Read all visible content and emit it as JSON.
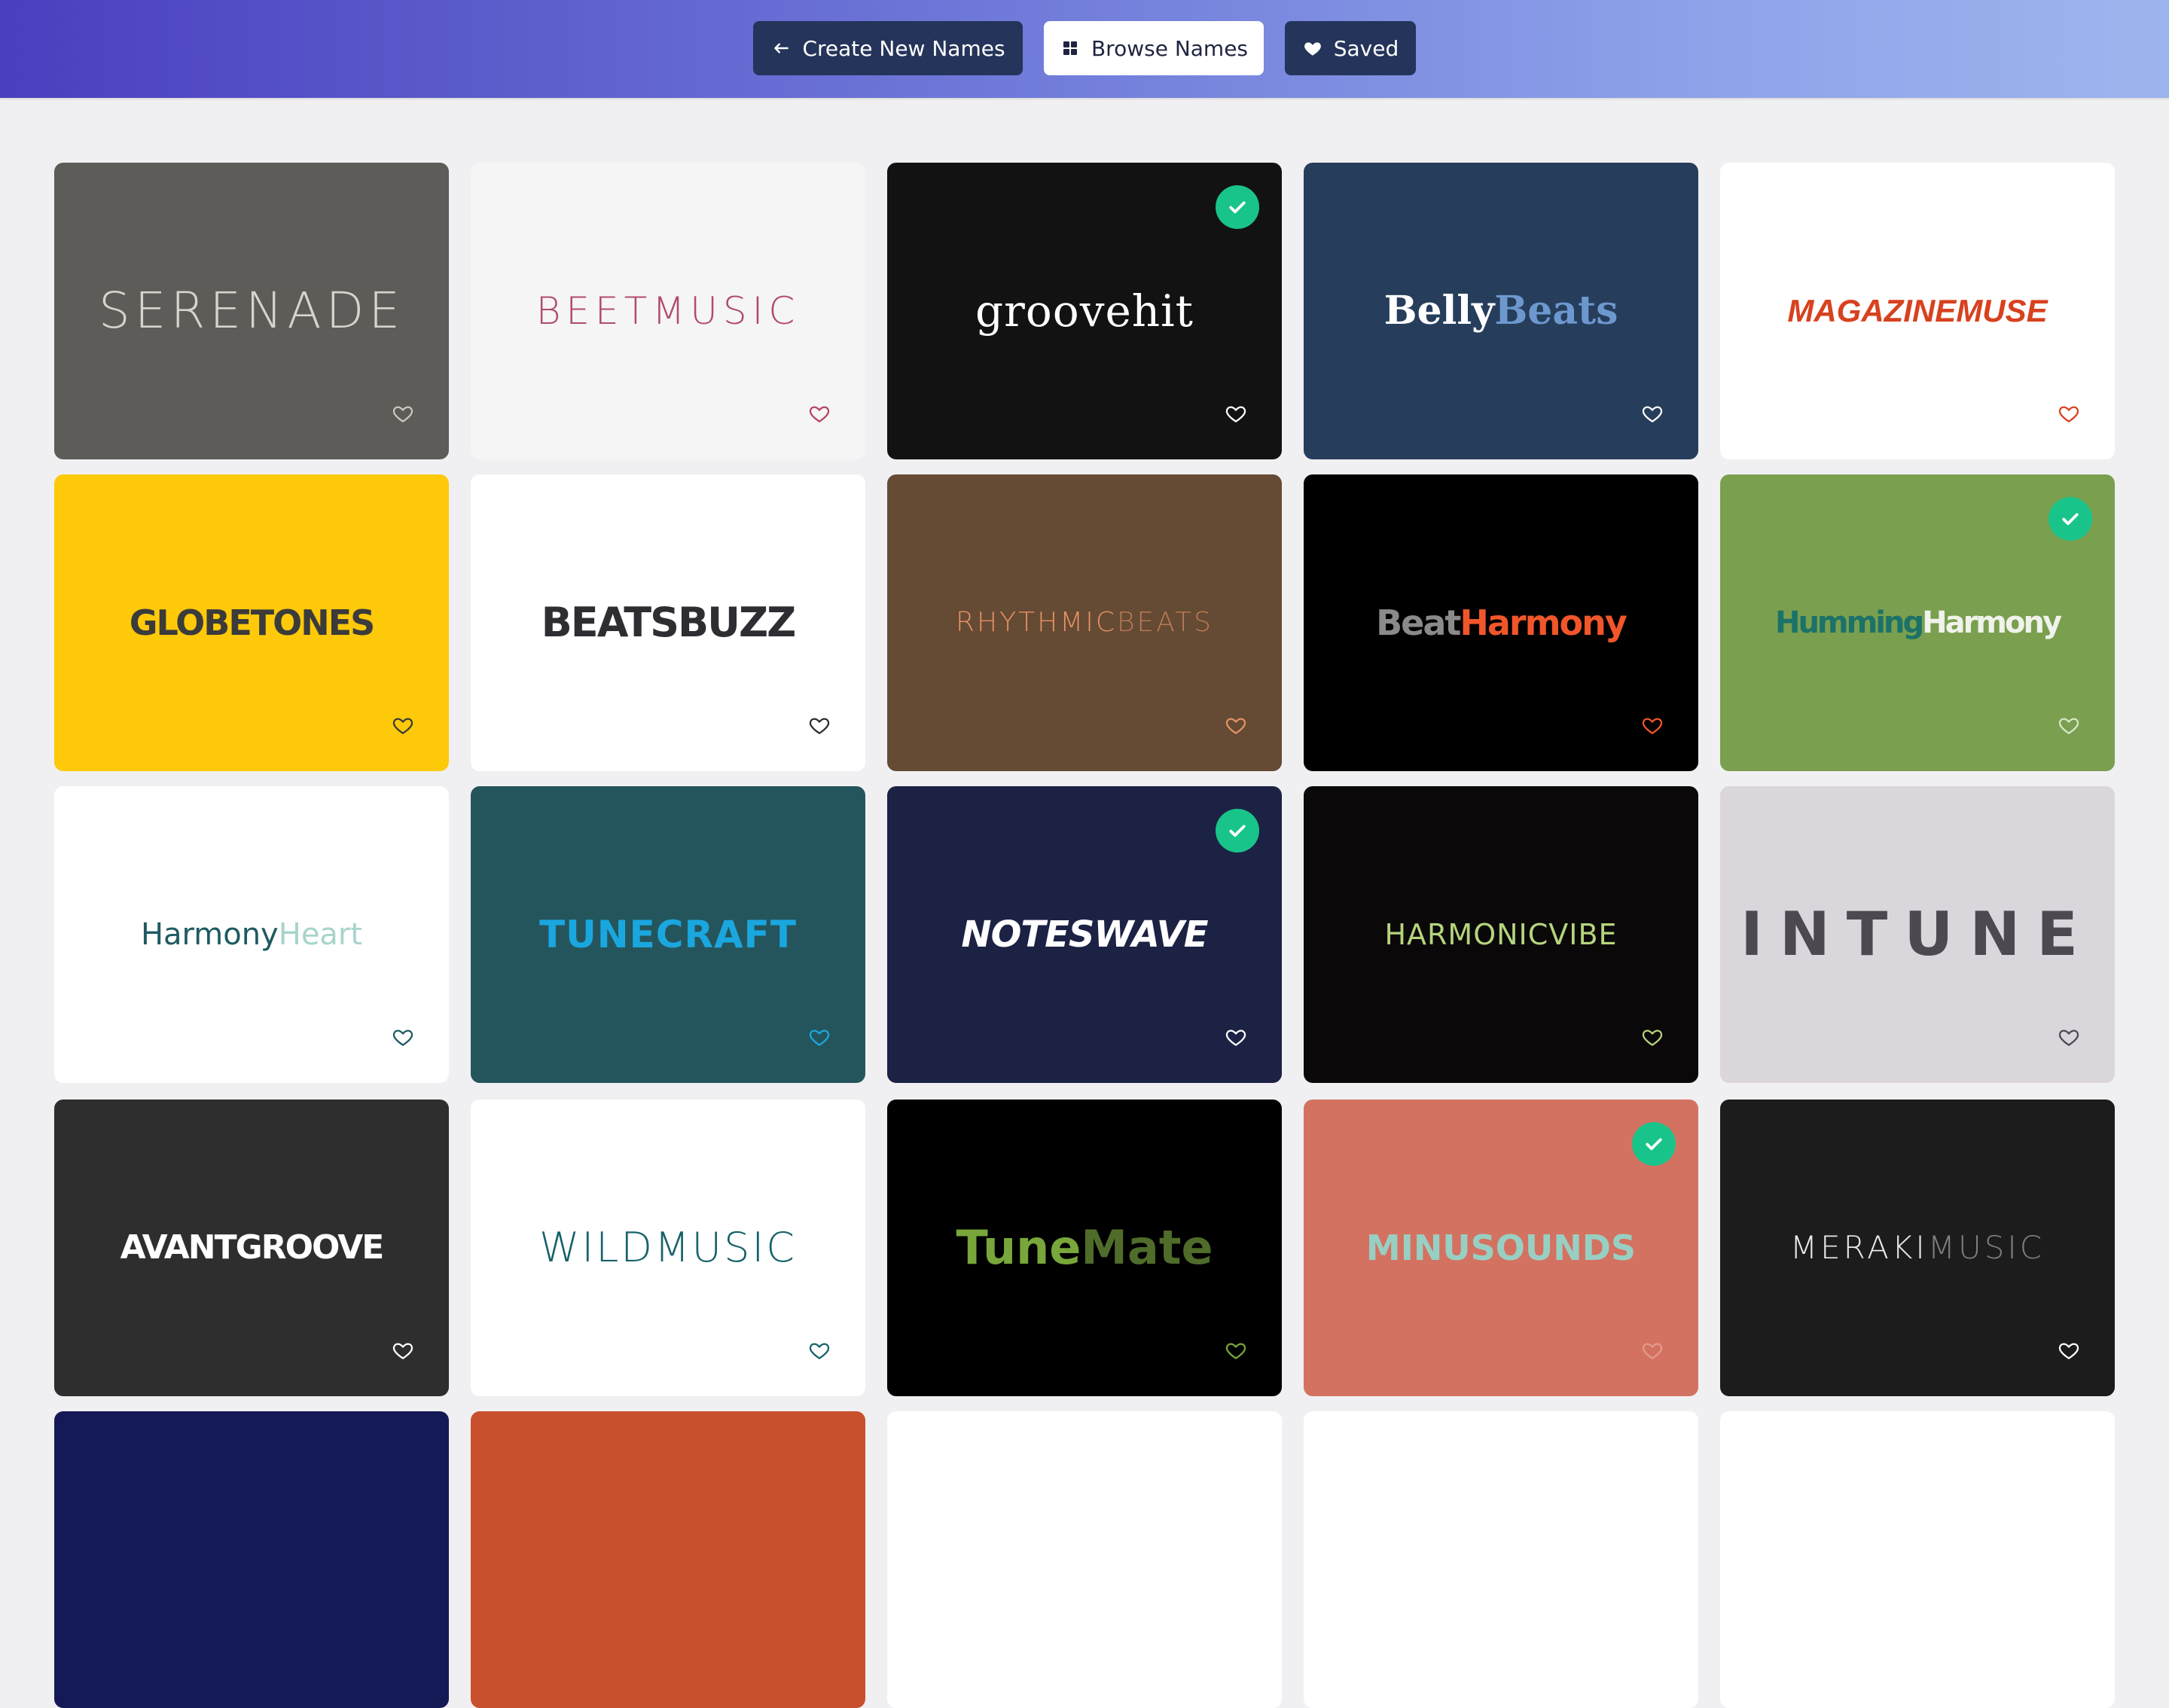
{
  "nav": {
    "create_label": "Create New Names",
    "create_icon": "arrow-left-icon",
    "browse_label": "Browse Names",
    "browse_icon": "grid-icon",
    "saved_label": "Saved",
    "saved_icon": "heart-filled-icon"
  },
  "colors": {
    "nav_dark": "#25345a",
    "check_green": "#19c48a"
  },
  "cards": [
    {
      "name": "SERENADE",
      "bg": "#5d5c58",
      "parts": [
        {
          "text": "SERENADE",
          "color": "#d6d4cc"
        }
      ],
      "heart": "#c9c7c0",
      "selected": false
    },
    {
      "name": "BEETMUSIC",
      "bg": "#f5f5f6",
      "parts": [
        {
          "text": "BEETMUSIC",
          "color": "#b14a6d"
        }
      ],
      "heart": "#b3465f",
      "selected": false
    },
    {
      "name": "groovehit",
      "bg": "#121212",
      "parts": [
        {
          "text": "groovehit",
          "color": "#ffffff"
        }
      ],
      "heart": "#ffffff",
      "selected": true
    },
    {
      "name": "BellyBeats",
      "bg": "#263e5b",
      "parts": [
        {
          "text": "Belly",
          "color": "#ffffff"
        },
        {
          "text": "Beats",
          "color": "#6d98cf"
        }
      ],
      "heart": "#ffffff",
      "selected": false
    },
    {
      "name": "MAGAZINEMUSE",
      "bg": "#ffffff",
      "parts": [
        {
          "text": "MAGAZINEMUSE",
          "color": "#d8411f"
        }
      ],
      "heart": "#d8411f",
      "selected": false
    },
    {
      "name": "GLOBETONES",
      "bg": "#fdc909",
      "parts": [
        {
          "text": "GLOBETONES",
          "color": "#3b3b3b"
        }
      ],
      "heart": "#3b3b3b",
      "selected": false
    },
    {
      "name": "BEATSBUZZ",
      "bg": "#ffffff",
      "parts": [
        {
          "text": "BEATSBUZZ",
          "color": "#2e2e32"
        }
      ],
      "heart": "#2e2e32",
      "selected": false
    },
    {
      "name": "RHYTHMICBEATS",
      "bg": "#654a34",
      "parts": [
        {
          "text": "RHYTHMIC",
          "color": "#e49263"
        },
        {
          "text": "BEATS",
          "color": "#b87b56"
        }
      ],
      "heart": "#e49263",
      "selected": false
    },
    {
      "name": "BeatHarmony",
      "bg": "#000000",
      "parts": [
        {
          "text": "Beat",
          "color": "#8a8a8a"
        },
        {
          "text": "Harmony",
          "color": "#f1562a"
        }
      ],
      "heart": "#f1562a",
      "selected": false
    },
    {
      "name": "HummingHarmony",
      "bg": "#7a9f4f",
      "parts": [
        {
          "text": "Humming",
          "color": "#1b7268"
        },
        {
          "text": "Harmony",
          "color": "#f0f2ec"
        }
      ],
      "heart": "#d9e6cb",
      "selected": true
    },
    {
      "name": "HarmonyHeart",
      "bg": "#ffffff",
      "parts": [
        {
          "text": "Harmony",
          "color": "#1e5a61"
        },
        {
          "text": "Heart",
          "color": "#a7d4cc"
        }
      ],
      "heart": "#1e5a61",
      "selected": false
    },
    {
      "name": "TUNECRAFT",
      "bg": "#25555c",
      "parts": [
        {
          "text": "TUNECRAFT",
          "color": "#1aa7e0"
        }
      ],
      "heart": "#1aa7e0",
      "selected": false
    },
    {
      "name": "NOTESWAVE",
      "bg": "#1c2244",
      "parts": [
        {
          "text": "NOTESWAVE",
          "color": "#ffffff"
        }
      ],
      "heart": "#ffffff",
      "selected": true
    },
    {
      "name": "HARMONICVIBE",
      "bg": "#0b0809",
      "parts": [
        {
          "text": "HARMONICVIBE",
          "color": "#b5d47d"
        }
      ],
      "heart": "#b5d47d",
      "selected": false
    },
    {
      "name": "INTUNE",
      "bg": "#dbd6dc",
      "parts": [
        {
          "text": "INTUNE",
          "color": "#4c4a50"
        }
      ],
      "heart": "#4c4a50",
      "selected": false
    },
    {
      "name": "AVANTGROOVE",
      "bg": "#2e2e2e",
      "parts": [
        {
          "text": "AVANTGROOVE",
          "color": "#ffffff"
        }
      ],
      "heart": "#ffffff",
      "selected": false
    },
    {
      "name": "WILDMUSIC",
      "bg": "#ffffff",
      "parts": [
        {
          "text": "WILDMUSIC",
          "color": "#17626a"
        }
      ],
      "heart": "#17626a",
      "selected": false
    },
    {
      "name": "TuneMate",
      "bg": "#000000",
      "parts": [
        {
          "text": "Tune",
          "color": "#78a63a"
        },
        {
          "text": "Mate",
          "color": "#4f6c2a"
        }
      ],
      "heart": "#78a63a",
      "selected": false
    },
    {
      "name": "MINUSOUNDS",
      "bg": "#d47261",
      "parts": [
        {
          "text": "MINUSOUNDS",
          "color": "#97d0c3"
        }
      ],
      "heart": "#e49a8c",
      "selected": true
    },
    {
      "name": "MERAKIMUSIC",
      "bg": "#1c1c1c",
      "parts": [
        {
          "text": "MERAKI",
          "color": "#e9e9e9"
        },
        {
          "text": "MUSIC",
          "color": "#7e7e7e"
        }
      ],
      "heart": "#ffffff",
      "selected": false
    },
    {
      "name": "",
      "bg": "#141a55",
      "parts": [],
      "heart": "",
      "selected": false
    },
    {
      "name": "",
      "bg": "#c9502d",
      "parts": [],
      "heart": "",
      "selected": false
    },
    {
      "name": "",
      "bg": "#ffffff",
      "parts": [],
      "heart": "",
      "selected": false
    },
    {
      "name": "",
      "bg": "#ffffff",
      "parts": [],
      "heart": "",
      "selected": false
    },
    {
      "name": "",
      "bg": "#ffffff",
      "parts": [],
      "heart": "",
      "selected": false
    }
  ]
}
